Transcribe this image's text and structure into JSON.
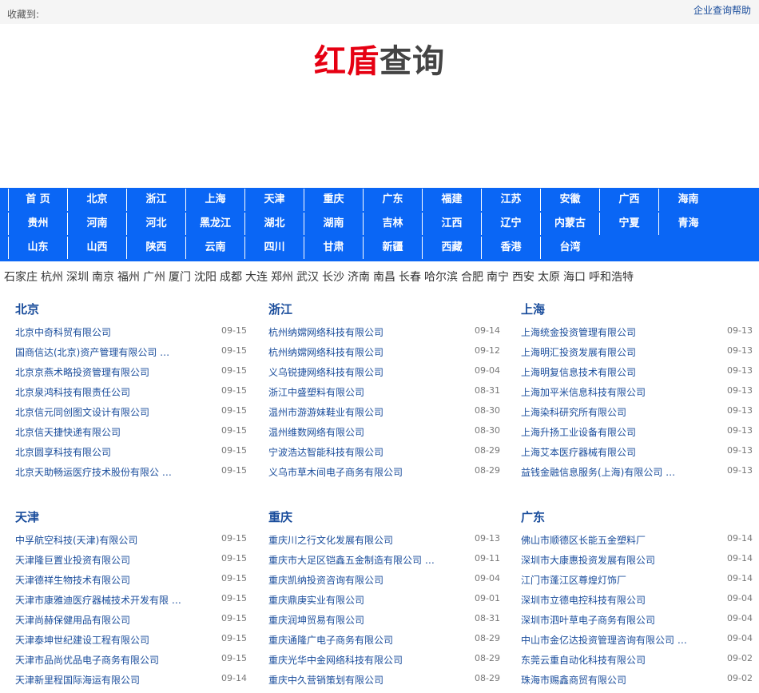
{
  "topbar": {
    "favorite_label": "收藏到:",
    "help_link": "企业查询帮助"
  },
  "logo": {
    "red": "红盾",
    "gray": "查询"
  },
  "nav": {
    "rows": [
      [
        "首 页",
        "北京",
        "浙江",
        "上海",
        "天津",
        "重庆",
        "广东",
        "福建",
        "江苏",
        "安徽",
        "广西",
        "海南"
      ],
      [
        "贵州",
        "河南",
        "河北",
        "黑龙江",
        "湖北",
        "湖南",
        "吉林",
        "江西",
        "辽宁",
        "内蒙古",
        "宁夏",
        "青海"
      ],
      [
        "山东",
        "山西",
        "陕西",
        "云南",
        "四川",
        "甘肃",
        "新疆",
        "西藏",
        "香港",
        "台湾"
      ]
    ]
  },
  "cities": [
    "石家庄",
    "杭州",
    "深圳",
    "南京",
    "福州",
    "广州",
    "厦门",
    "沈阳",
    "成都",
    "大连",
    "郑州",
    "武汉",
    "长沙",
    "济南",
    "南昌",
    "长春",
    "哈尔滨",
    "合肥",
    "南宁",
    "西安",
    "太原",
    "海口",
    "呼和浩特"
  ],
  "sections": [
    {
      "title": "北京",
      "items": [
        {
          "name": "北京中奇科贸有限公司",
          "date": "09-15"
        },
        {
          "name": "国商信达(北京)资产管理有限公司 …",
          "date": "09-15"
        },
        {
          "name": "北京京燕术略投资管理有限公司",
          "date": "09-15"
        },
        {
          "name": "北京泉鸿科技有限责任公司",
          "date": "09-15"
        },
        {
          "name": "北京信元同创图文设计有限公司",
          "date": "09-15"
        },
        {
          "name": "北京信天捷快递有限公司",
          "date": "09-15"
        },
        {
          "name": "北京圆享科技有限公司",
          "date": "09-15"
        },
        {
          "name": "北京天助畅运医疗技术股份有限公 …",
          "date": "09-15"
        }
      ]
    },
    {
      "title": "浙江",
      "items": [
        {
          "name": "杭州纳嫦网络科技有限公司",
          "date": "09-14"
        },
        {
          "name": "杭州纳嫦网络科技有限公司",
          "date": "09-12"
        },
        {
          "name": "义乌锐捷网络科技有限公司",
          "date": "09-04"
        },
        {
          "name": "浙江中盛塑料有限公司",
          "date": "08-31"
        },
        {
          "name": "温州市游游妹鞋业有限公司",
          "date": "08-30"
        },
        {
          "name": "温州维数网络有限公司",
          "date": "08-30"
        },
        {
          "name": "宁波浩达智能科技有限公司",
          "date": "08-29"
        },
        {
          "name": "义乌市草木间电子商务有限公司",
          "date": "08-29"
        }
      ]
    },
    {
      "title": "上海",
      "items": [
        {
          "name": "上海统金投资管理有限公司",
          "date": "09-13"
        },
        {
          "name": "上海明汇投资发展有限公司",
          "date": "09-13"
        },
        {
          "name": "上海明复信息技术有限公司",
          "date": "09-13"
        },
        {
          "name": "上海加平米信息科技有限公司",
          "date": "09-13"
        },
        {
          "name": "上海染科研究所有限公司",
          "date": "09-13"
        },
        {
          "name": "上海升扬工业设备有限公司",
          "date": "09-13"
        },
        {
          "name": "上海艾本医疗器械有限公司",
          "date": "09-13"
        },
        {
          "name": "益钱金融信息服务(上海)有限公司 …",
          "date": "09-13"
        }
      ]
    },
    {
      "title": "天津",
      "items": [
        {
          "name": "中孚航空科技(天津)有限公司",
          "date": "09-15"
        },
        {
          "name": "天津隆巨置业投资有限公司",
          "date": "09-15"
        },
        {
          "name": "天津德祥生物技术有限公司",
          "date": "09-15"
        },
        {
          "name": "天津市康雅迪医疗器械技术开发有限 …",
          "date": "09-15"
        },
        {
          "name": "天津尚赫保健用品有限公司",
          "date": "09-15"
        },
        {
          "name": "天津泰坤世纪建设工程有限公司",
          "date": "09-15"
        },
        {
          "name": "天津市品尚优品电子商务有限公司",
          "date": "09-15"
        },
        {
          "name": "天津新里程国际海运有限公司",
          "date": "09-14"
        }
      ]
    },
    {
      "title": "重庆",
      "items": [
        {
          "name": "重庆川之行文化发展有限公司",
          "date": "09-13"
        },
        {
          "name": "重庆市大足区铠鑫五金制造有限公司 …",
          "date": "09-11"
        },
        {
          "name": "重庆凯纳投资咨询有限公司",
          "date": "09-04"
        },
        {
          "name": "重庆鼎庚实业有限公司",
          "date": "09-01"
        },
        {
          "name": "重庆润坤贸易有限公司",
          "date": "08-31"
        },
        {
          "name": "重庆通隆广电子商务有限公司",
          "date": "08-29"
        },
        {
          "name": "重庆光华中金网络科技有限公司",
          "date": "08-29"
        },
        {
          "name": "重庆中久营销策划有限公司",
          "date": "08-29"
        }
      ]
    },
    {
      "title": "广东",
      "items": [
        {
          "name": "佛山市顺德区长能五金塑料厂",
          "date": "09-14"
        },
        {
          "name": "深圳市大康惠投资发展有限公司",
          "date": "09-14"
        },
        {
          "name": "江门市蓬江区尊煌灯饰厂",
          "date": "09-14"
        },
        {
          "name": "深圳市立德电控科技有限公司",
          "date": "09-04"
        },
        {
          "name": "深圳市泗叶草电子商务有限公司",
          "date": "09-04"
        },
        {
          "name": "中山市金亿达投资管理咨询有限公司 …",
          "date": "09-04"
        },
        {
          "name": "东莞云重自动化科技有限公司",
          "date": "09-02"
        },
        {
          "name": "珠海市赐鑫商贸有限公司",
          "date": "09-02"
        }
      ]
    }
  ]
}
